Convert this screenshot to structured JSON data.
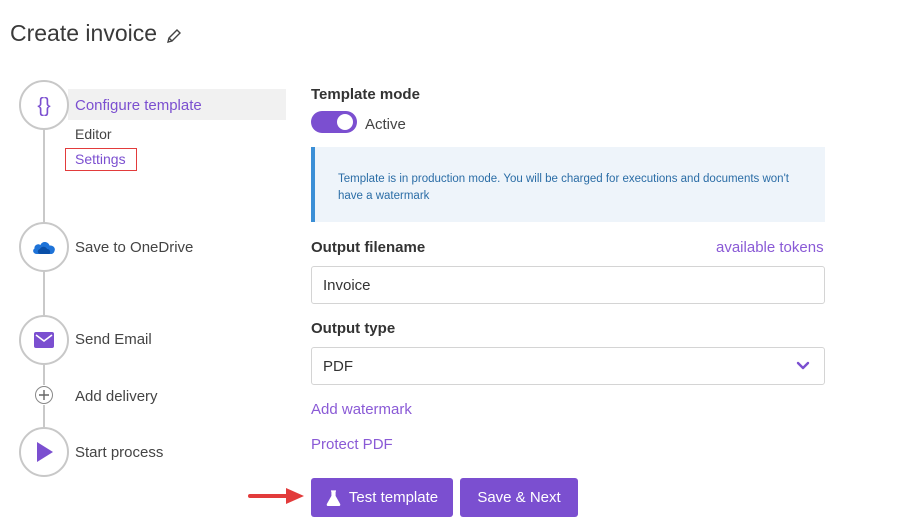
{
  "header": {
    "title": "Create invoice",
    "edit_icon": "pencil-icon"
  },
  "stepper": {
    "steps": [
      {
        "label": "Configure template",
        "icon": "braces-icon",
        "active": true
      },
      {
        "label": "Save to OneDrive",
        "icon": "onedrive-cloud-icon"
      },
      {
        "label": "Send Email",
        "icon": "envelope-icon"
      },
      {
        "label": "Add delivery",
        "icon": "plus-circle-icon"
      },
      {
        "label": "Start process",
        "icon": "play-icon"
      }
    ],
    "sub_items": [
      {
        "label": "Editor"
      },
      {
        "label": "Settings",
        "highlighted": true
      }
    ]
  },
  "form": {
    "template_mode": {
      "title": "Template mode",
      "toggle_on": true,
      "toggle_label": "Active"
    },
    "info": {
      "text": "Template is in production mode. You will be charged for executions and documents won't have a watermark"
    },
    "output_filename": {
      "title": "Output filename",
      "tokens_link": "available tokens",
      "value": "Invoice"
    },
    "output_type": {
      "title": "Output type",
      "selected": "PDF"
    },
    "add_watermark": "Add watermark",
    "protect_pdf": "Protect PDF",
    "buttons": {
      "test": "Test template",
      "save_next": "Save & Next"
    }
  },
  "colors": {
    "accent": "#7b4fd0",
    "info_bg": "#eef4fa",
    "info_border": "#3b8fd6",
    "highlight": "#e23b3b"
  }
}
